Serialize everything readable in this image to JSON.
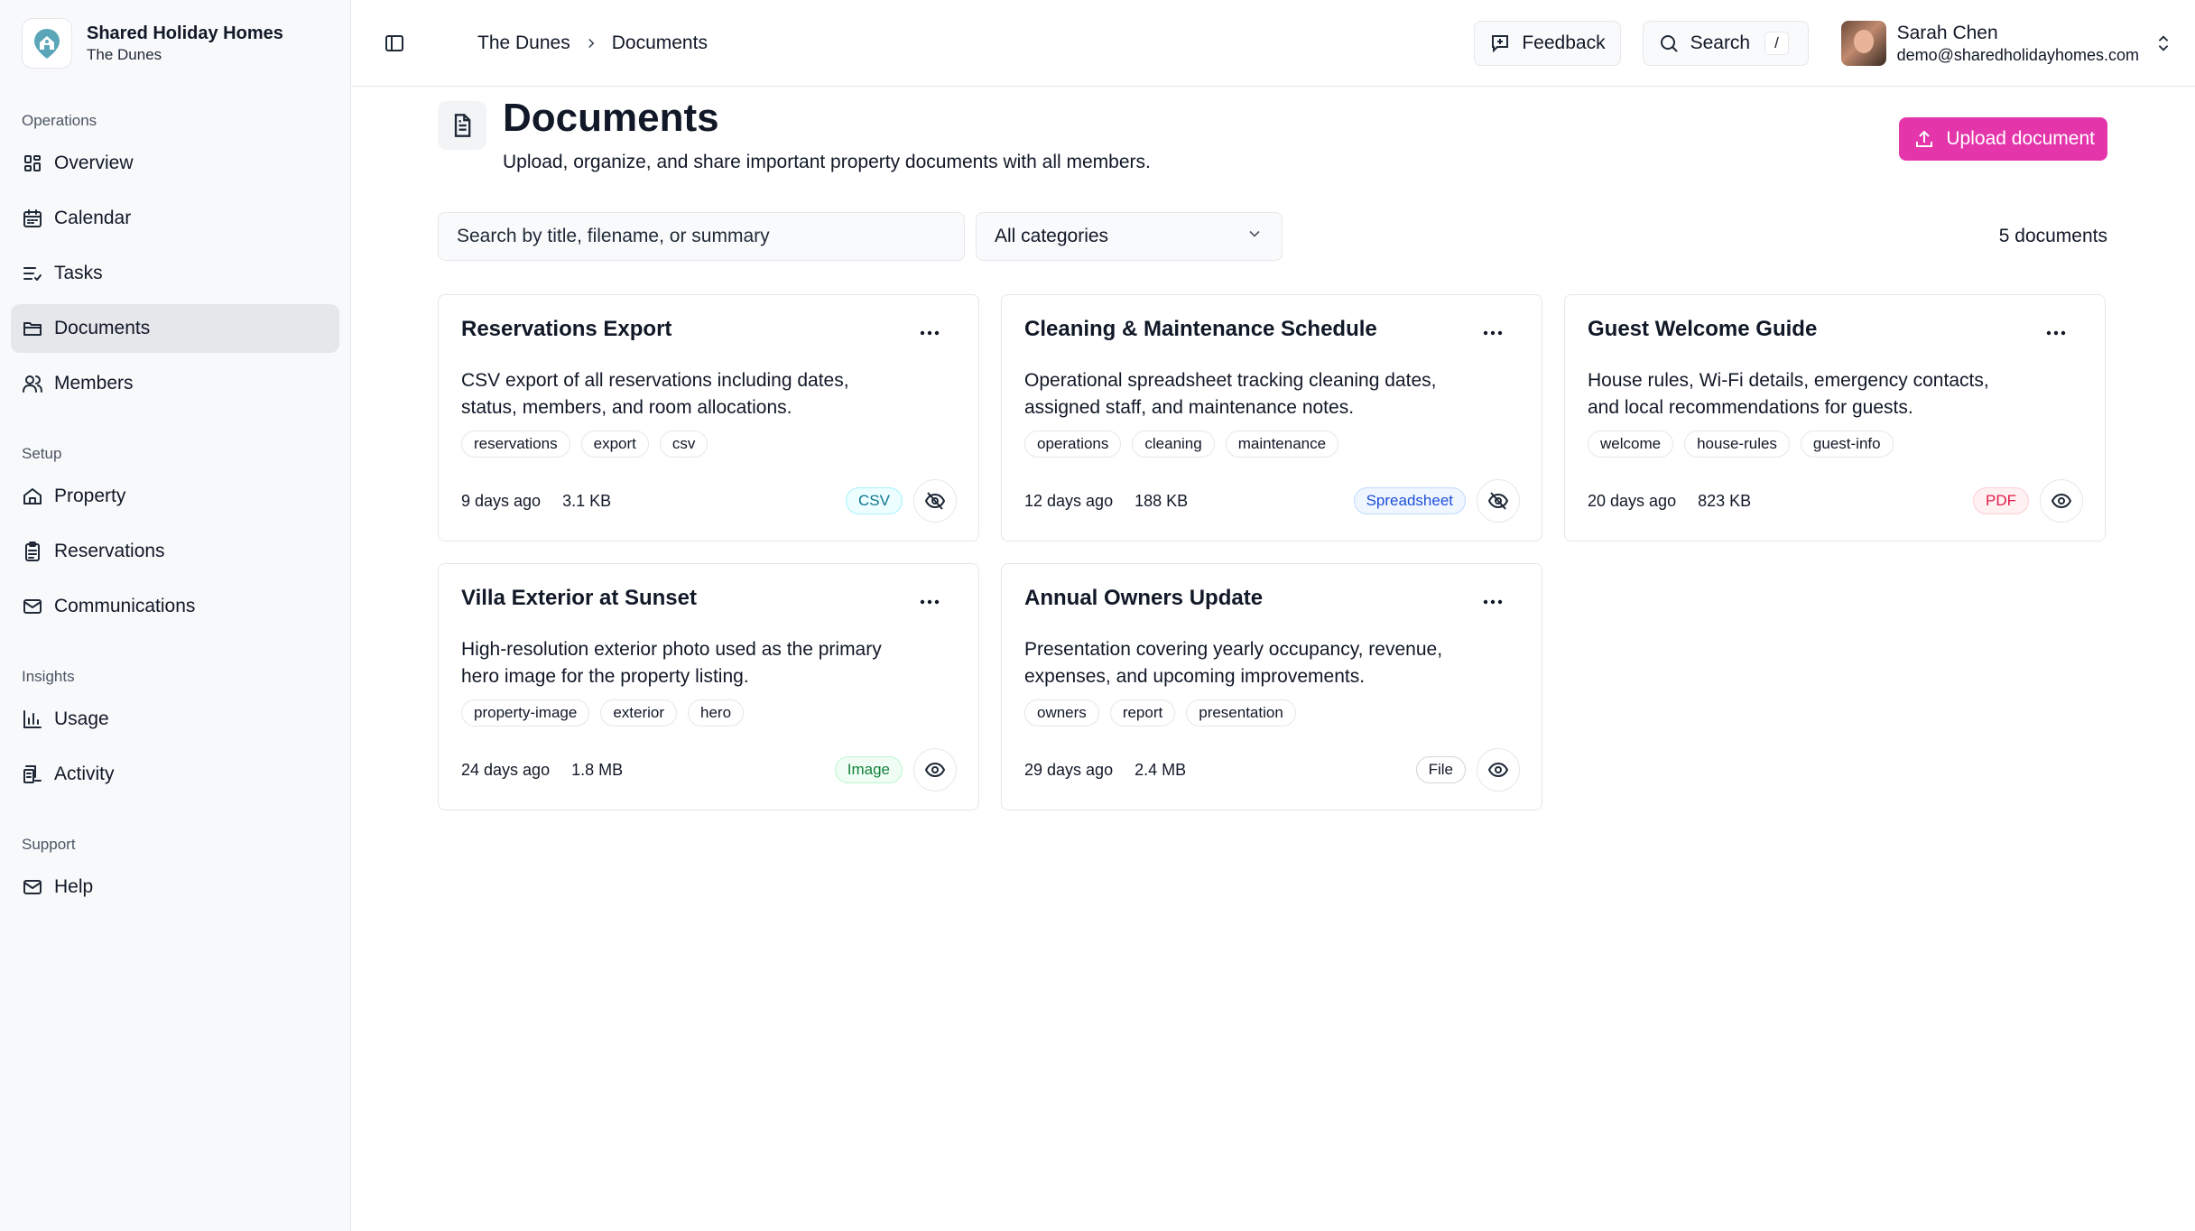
{
  "brand": {
    "name": "Shared Holiday Homes",
    "property": "The Dunes"
  },
  "sidebar": {
    "sections": [
      {
        "label": "Operations",
        "items": [
          {
            "label": "Overview",
            "icon": "grid-icon",
            "active": false
          },
          {
            "label": "Calendar",
            "icon": "calendar-icon",
            "active": false
          },
          {
            "label": "Tasks",
            "icon": "list-check-icon",
            "active": false
          },
          {
            "label": "Documents",
            "icon": "folder-icon",
            "active": true
          },
          {
            "label": "Members",
            "icon": "users-icon",
            "active": false
          }
        ]
      },
      {
        "label": "Setup",
        "items": [
          {
            "label": "Property",
            "icon": "home-icon",
            "active": false
          },
          {
            "label": "Reservations",
            "icon": "clipboard-icon",
            "active": false
          },
          {
            "label": "Communications",
            "icon": "mail-icon",
            "active": false
          }
        ]
      },
      {
        "label": "Insights",
        "items": [
          {
            "label": "Usage",
            "icon": "bar-chart-icon",
            "active": false
          },
          {
            "label": "Activity",
            "icon": "activity-log-icon",
            "active": false
          }
        ]
      },
      {
        "label": "Support",
        "items": [
          {
            "label": "Help",
            "icon": "mail-icon",
            "active": false
          }
        ]
      }
    ]
  },
  "topbar": {
    "breadcrumb": [
      "The Dunes",
      "Documents"
    ],
    "feedback_label": "Feedback",
    "search_label": "Search",
    "search_shortcut": "/",
    "user": {
      "name": "Sarah Chen",
      "email": "demo@sharedholidayhomes.com"
    }
  },
  "page": {
    "title": "Documents",
    "subtitle": "Upload, organize, and share important property documents with all members.",
    "upload_label": "Upload document",
    "search_placeholder": "Search by title, filename, or summary",
    "category_selected": "All categories",
    "count_label": "5 documents"
  },
  "colors": {
    "accent": "#e535ab",
    "csv": {
      "text": "#0e7490",
      "bg": "#ecfeff",
      "border": "#a5f3fc"
    },
    "spreadsheet": {
      "text": "#1d4ed8",
      "bg": "#eff6ff",
      "border": "#bfdbfe"
    },
    "pdf": {
      "text": "#e11d48",
      "bg": "#fff1f2",
      "border": "#fecdd3"
    },
    "image": {
      "text": "#15803d",
      "bg": "#f0fdf4",
      "border": "#bbf7d0"
    },
    "file": {
      "text": "#111827",
      "bg": "#ffffff",
      "border": "#d1d5db"
    }
  },
  "documents": [
    {
      "title": "Reservations Export",
      "summary": "CSV export of all reservations including dates, status, members, and room allocations.",
      "tags": [
        "reservations",
        "export",
        "csv"
      ],
      "age": "9 days ago",
      "size": "3.1 KB",
      "type": "CSV",
      "type_key": "csv",
      "visibility": "hidden"
    },
    {
      "title": "Cleaning & Maintenance Schedule",
      "summary": "Operational spreadsheet tracking cleaning dates, assigned staff, and maintenance notes.",
      "tags": [
        "operations",
        "cleaning",
        "maintenance"
      ],
      "age": "12 days ago",
      "size": "188 KB",
      "type": "Spreadsheet",
      "type_key": "spreadsheet",
      "visibility": "hidden"
    },
    {
      "title": "Guest Welcome Guide",
      "summary": "House rules, Wi-Fi details, emergency contacts, and local recommendations for guests.",
      "tags": [
        "welcome",
        "house-rules",
        "guest-info"
      ],
      "age": "20 days ago",
      "size": "823 KB",
      "type": "PDF",
      "type_key": "pdf",
      "visibility": "visible"
    },
    {
      "title": "Villa Exterior at Sunset",
      "summary": "High-resolution exterior photo used as the primary hero image for the property listing.",
      "tags": [
        "property-image",
        "exterior",
        "hero"
      ],
      "age": "24 days ago",
      "size": "1.8 MB",
      "type": "Image",
      "type_key": "image",
      "visibility": "visible"
    },
    {
      "title": "Annual Owners Update",
      "summary": "Presentation covering yearly occupancy, revenue, expenses, and upcoming improvements.",
      "tags": [
        "owners",
        "report",
        "presentation"
      ],
      "age": "29 days ago",
      "size": "2.4 MB",
      "type": "File",
      "type_key": "file",
      "visibility": "visible"
    }
  ]
}
